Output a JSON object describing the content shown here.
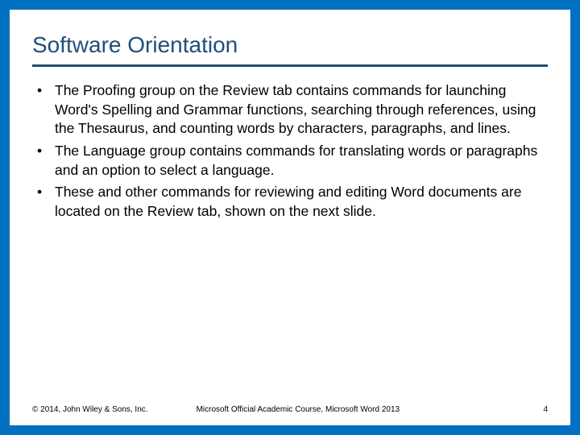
{
  "title": "Software Orientation",
  "bullets": [
    "The Proofing group on the Review tab contains commands for launching Word's Spelling and Grammar functions, searching through references, using the Thesaurus, and counting words by characters, paragraphs, and lines.",
    "The Language group contains commands for translating words or paragraphs and an option to select a language.",
    "These and other commands for reviewing and editing Word documents are located on the Review tab, shown on the next slide."
  ],
  "footer": {
    "copyright": "© 2014, John Wiley & Sons, Inc.",
    "center": "Microsoft Official Academic Course, Microsoft Word 2013",
    "page": "4"
  }
}
